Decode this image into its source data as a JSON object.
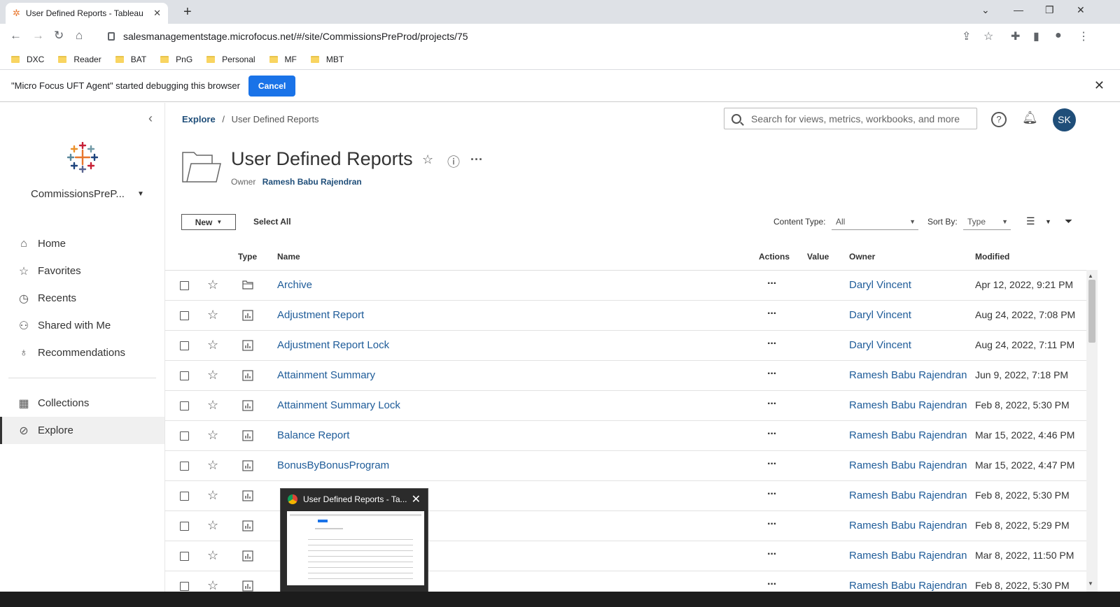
{
  "browser": {
    "tab_title": "User Defined Reports - Tableau S",
    "url": "salesmanagementstage.microfocus.net/#/site/CommissionsPreProd/projects/75",
    "bookmarks": [
      "DXC",
      "Reader",
      "BAT",
      "PnG",
      "Personal",
      "MF",
      "MBT"
    ]
  },
  "infobar": {
    "message": "\"Micro Focus UFT Agent\" started debugging this browser",
    "cancel_label": "Cancel"
  },
  "sidebar": {
    "site_name": "CommissionsPreP...",
    "items": [
      {
        "label": "Home",
        "icon": "home-icon"
      },
      {
        "label": "Favorites",
        "icon": "star-icon"
      },
      {
        "label": "Recents",
        "icon": "clock-icon"
      },
      {
        "label": "Shared with Me",
        "icon": "shared-icon"
      },
      {
        "label": "Recommendations",
        "icon": "lightbulb-icon"
      },
      {
        "label": "Collections",
        "icon": "collections-icon"
      },
      {
        "label": "Explore",
        "icon": "explore-icon"
      }
    ]
  },
  "header": {
    "breadcrumb_root": "Explore",
    "breadcrumb_sep": "/",
    "breadcrumb_current": "User Defined Reports",
    "search_placeholder": "Search for views, metrics, workbooks, and more",
    "avatar_initials": "SK"
  },
  "project": {
    "title": "User Defined Reports",
    "owner_label": "Owner",
    "owner_name": "Ramesh Babu Rajendran"
  },
  "controls": {
    "new_label": "New",
    "select_all_label": "Select All",
    "content_type_label": "Content Type:",
    "content_type_value": "All",
    "sort_by_label": "Sort By:",
    "sort_by_value": "Type"
  },
  "table": {
    "columns": {
      "type": "Type",
      "name": "Name",
      "actions": "Actions",
      "value": "Value",
      "owner": "Owner",
      "modified": "Modified"
    },
    "rows": [
      {
        "kind": "folder",
        "name": "Archive",
        "owner": "Daryl Vincent",
        "modified": "Apr 12, 2022, 9:21 PM"
      },
      {
        "kind": "view",
        "name": "Adjustment Report",
        "owner": "Daryl Vincent",
        "modified": "Aug 24, 2022, 7:08 PM"
      },
      {
        "kind": "view",
        "name": "Adjustment Report Lock",
        "owner": "Daryl Vincent",
        "modified": "Aug 24, 2022, 7:11 PM"
      },
      {
        "kind": "view",
        "name": "Attainment Summary",
        "owner": "Ramesh Babu Rajendran",
        "modified": "Jun 9, 2022, 7:18 PM"
      },
      {
        "kind": "view",
        "name": "Attainment Summary Lock",
        "owner": "Ramesh Babu Rajendran",
        "modified": "Feb 8, 2022, 5:30 PM"
      },
      {
        "kind": "view",
        "name": "Balance Report",
        "owner": "Ramesh Babu Rajendran",
        "modified": "Mar 15, 2022, 4:46 PM"
      },
      {
        "kind": "view",
        "name": "BonusByBonusProgram",
        "owner": "Ramesh Babu Rajendran",
        "modified": "Mar 15, 2022, 4:47 PM"
      },
      {
        "kind": "view",
        "name": "",
        "owner": "Ramesh Babu Rajendran",
        "modified": "Feb 8, 2022, 5:30 PM"
      },
      {
        "kind": "view",
        "name": "",
        "owner": "Ramesh Babu Rajendran",
        "modified": "Feb 8, 2022, 5:29 PM"
      },
      {
        "kind": "view",
        "name": "",
        "owner": "Ramesh Babu Rajendran",
        "modified": "Mar 8, 2022, 11:50 PM"
      },
      {
        "kind": "view",
        "name": "",
        "owner": "Ramesh Babu Rajendran",
        "modified": "Feb 8, 2022, 5:30 PM"
      }
    ]
  },
  "preview": {
    "title": "User Defined Reports - Ta..."
  },
  "colors": {
    "accent": "#1f4e79",
    "link": "#1f5c99",
    "chrome_button": "#1a73e8"
  }
}
